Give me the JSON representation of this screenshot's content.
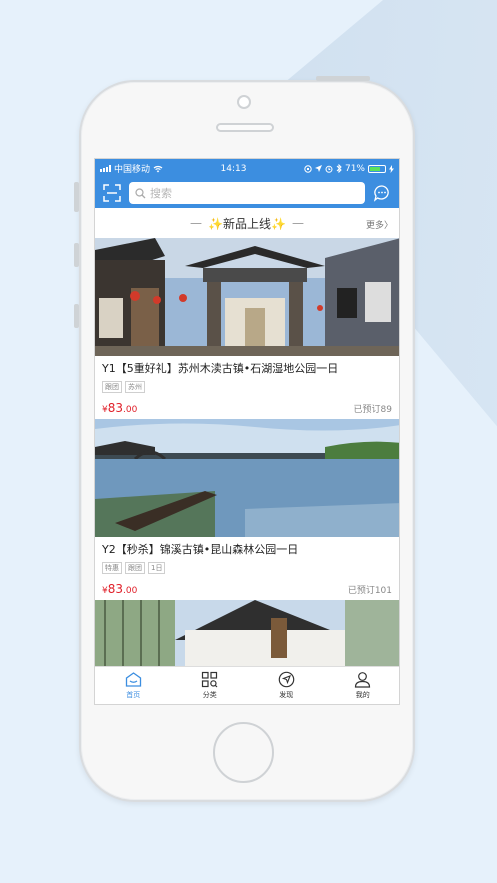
{
  "status_bar": {
    "carrier": "中国移动",
    "time": "14:13",
    "battery": "71%",
    "battery_level": 0.71
  },
  "top_bar": {
    "search_placeholder": "搜索",
    "scan_icon": "scan-icon",
    "chat_icon": "chat-icon"
  },
  "section": {
    "title": "✨新品上线✨",
    "more": "更多"
  },
  "products": [
    {
      "title": "Y1【5重好礼】苏州木渎古镇•石湖湿地公园一日",
      "tags": [
        "跟团",
        "苏州"
      ],
      "price_symbol": "¥",
      "price_int": "83",
      "price_dec": ".00",
      "booked": "已预订89"
    },
    {
      "title": "Y2【秒杀】锦溪古镇•昆山森林公园一日",
      "tags": [
        "特惠",
        "跟团",
        "1日"
      ],
      "price_symbol": "¥",
      "price_int": "83",
      "price_dec": ".00",
      "booked": "已预订101"
    }
  ],
  "tabbar": {
    "items": [
      {
        "label": "首页",
        "icon": "home-icon",
        "active": true
      },
      {
        "label": "分类",
        "icon": "grid-search-icon",
        "active": false
      },
      {
        "label": "发现",
        "icon": "compass-icon",
        "active": false
      },
      {
        "label": "我的",
        "icon": "user-icon",
        "active": false
      }
    ]
  },
  "colors": {
    "accent": "#3c8ee0",
    "price": "#e0202a",
    "background": "#e6f1fb"
  }
}
